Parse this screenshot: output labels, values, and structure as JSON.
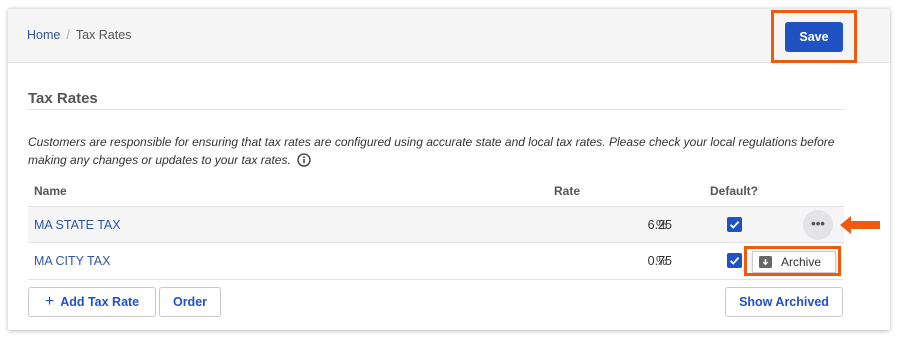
{
  "breadcrumb": {
    "home": "Home",
    "separator": "/",
    "current": "Tax Rates"
  },
  "toolbar": {
    "save_label": "Save"
  },
  "section": {
    "title": "Tax Rates",
    "notice": "Customers are responsible for ensuring that tax rates are configured using accurate state and local tax rates. Please check your local regulations before making any changes or updates to your tax rates."
  },
  "table": {
    "columns": {
      "name": "Name",
      "rate": "Rate",
      "default": "Default?"
    },
    "rows": [
      {
        "name": "MA STATE TAX",
        "rate": "6.25",
        "unit": "%",
        "default": true
      },
      {
        "name": "MA CITY TAX",
        "rate": "0.75",
        "unit": "%",
        "default": true
      }
    ]
  },
  "row_menu": {
    "more_label": "•••",
    "archive_label": "Archive"
  },
  "actions": {
    "add_label": "Add Tax Rate",
    "add_prefix": "+",
    "order_label": "Order",
    "show_archived_label": "Show Archived"
  },
  "colors": {
    "accent": "#2152c3",
    "link": "#2f55a4",
    "callout": "#ef5a0c"
  },
  "icons": [
    "info-icon",
    "checkbox-checked-icon",
    "more-horizontal-icon",
    "archive-icon",
    "plus-icon",
    "arrow-left-icon"
  ]
}
